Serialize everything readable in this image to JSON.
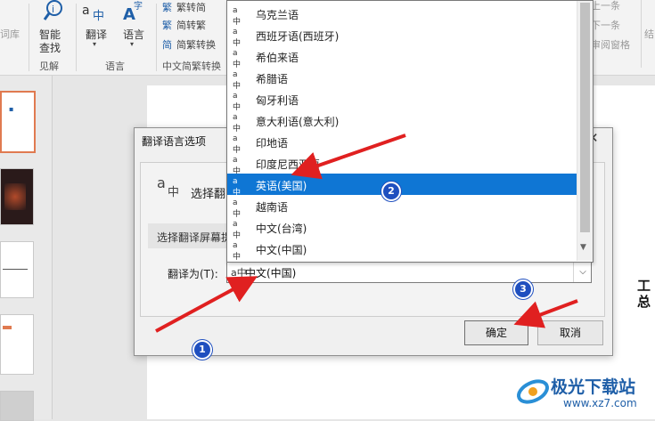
{
  "ribbon": {
    "words_label": "词库",
    "smart_lookup": [
      "智能",
      "查找"
    ],
    "insights_group": "见解",
    "translate_label": "翻译",
    "language_label": "语言",
    "language_group": "语言",
    "trad_to_simp": "繁转简",
    "simp_to_trad": "简转繁",
    "simp_trad_convert": "简繁转换",
    "chinese_convert_group": "中文简繁转换",
    "prev_label": "上一条",
    "next_label": "下一条",
    "review_pane": "审阅窗格",
    "end_label": "结"
  },
  "dialog": {
    "title": "翻译语言选项",
    "select_text": "选择翻",
    "screen_tip_label": "选择翻译屏幕提",
    "translate_to_label": "翻译为(T):",
    "selected_value": "中文(中国)",
    "ok_label": "确定",
    "cancel_label": "取消"
  },
  "dropdown": {
    "items": [
      "乌克兰语",
      "西班牙语(西班牙)",
      "希伯来语",
      "希腊语",
      "匈牙利语",
      "意大利语(意大利)",
      "印地语",
      "印度尼西亚语",
      "英语(美国)",
      "越南语",
      "中文(台湾)",
      "中文(中国)"
    ],
    "selected_index": 8
  },
  "slide": {
    "side_text": [
      "工",
      "总"
    ]
  },
  "annotations": {
    "badges": [
      "1",
      "2",
      "3"
    ],
    "arrow_color": "#e02020"
  },
  "watermark": {
    "name": "极光下载站",
    "url": "www.xz7.com"
  }
}
